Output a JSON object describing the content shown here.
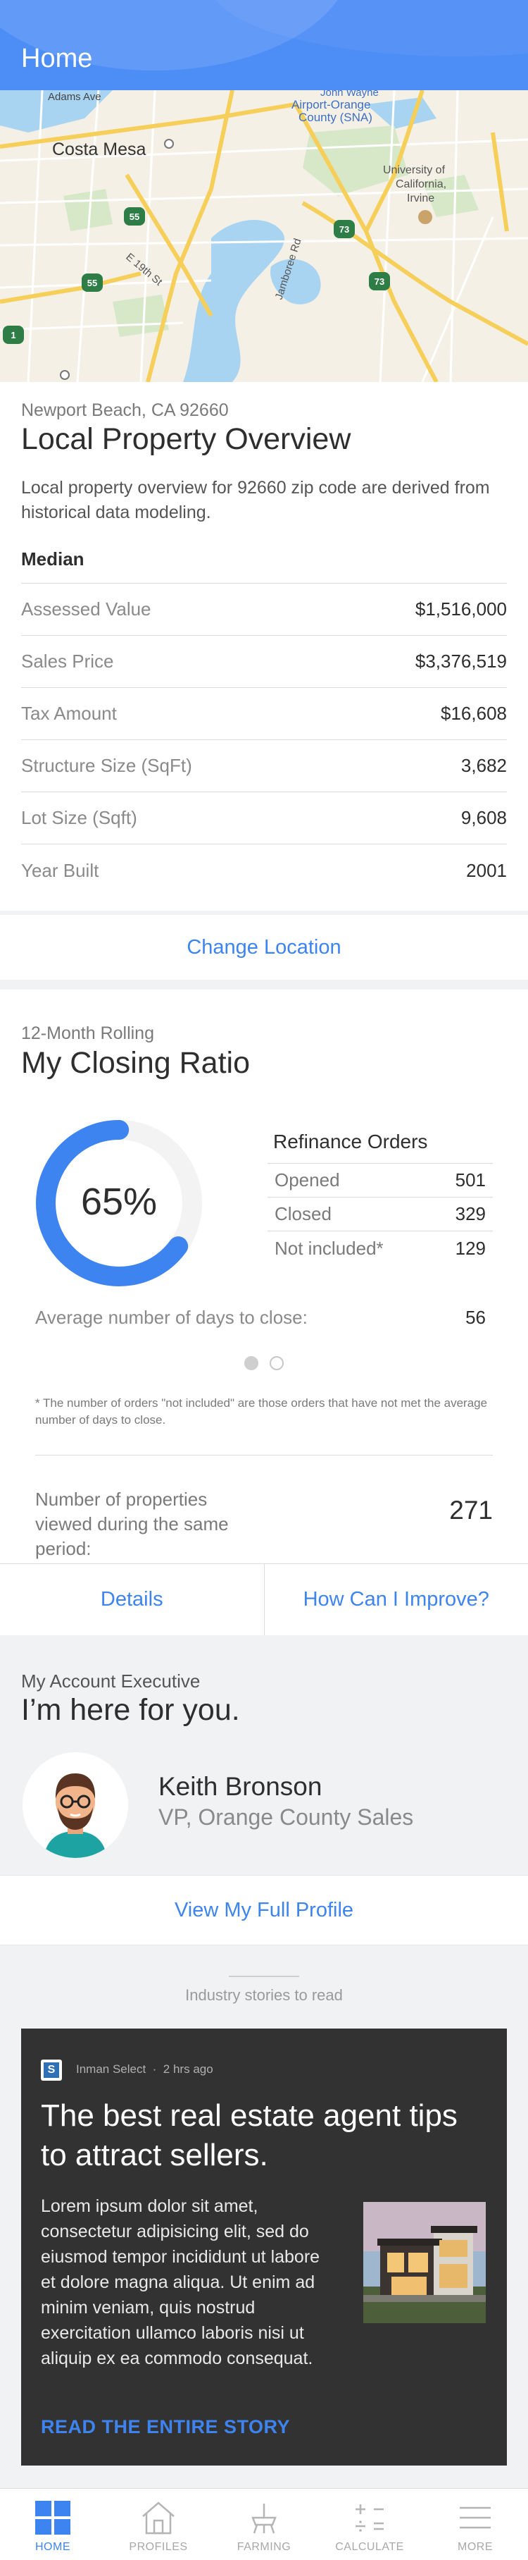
{
  "header": {
    "title": "Home"
  },
  "map": {
    "labels": {
      "adams_ave": "Adams Ave",
      "costa_mesa": "Costa Mesa",
      "airport": [
        "John Wayne",
        "Airport-Orange",
        "County (SNA)"
      ],
      "university": [
        "University of",
        "California,",
        "Irvine"
      ],
      "e19th": "E 19th St",
      "jamboree": "Jamboree Rd",
      "shield_55a": "55",
      "shield_55b": "55",
      "shield_73a": "73",
      "shield_73b": "73",
      "shield_1": "1"
    }
  },
  "overview": {
    "location": "Newport Beach, CA 92660",
    "title": "Local Property Overview",
    "description": "Local property overview for 92660 zip code are derived from historical data modeling.",
    "median_label": "Median",
    "rows": [
      {
        "label": "Assessed Value",
        "value": "$1,516,000"
      },
      {
        "label": "Sales Price",
        "value": "$3,376,519"
      },
      {
        "label": "Tax Amount",
        "value": "$16,608"
      },
      {
        "label": "Structure Size (SqFt)",
        "value": "3,682"
      },
      {
        "label": "Lot Size (Sqft)",
        "value": "9,608"
      },
      {
        "label": "Year Built",
        "value": "2001"
      }
    ],
    "change_location": "Change Location"
  },
  "closing": {
    "subtitle": "12-Month Rolling",
    "title": "My Closing Ratio",
    "percent_text": "65%",
    "percent_value": 0.65,
    "refinance_title": "Refinance Orders",
    "refinance_rows": [
      {
        "label": "Opened",
        "value": "501"
      },
      {
        "label": "Closed",
        "value": "329"
      },
      {
        "label": "Not included*",
        "value": "129"
      }
    ],
    "avg_label": "Average number of days to close:",
    "avg_value": "56",
    "footnote": "* The number of orders \"not included\" are those orders that have not met the average number of days to close.",
    "viewed_label": "Number of properties viewed during the same period:",
    "viewed_value": "271",
    "details_label": "Details",
    "improve_label": "How Can I Improve?",
    "accent_color": "#3d84f0"
  },
  "executive": {
    "subtitle": "My Account Executive",
    "title": "I’m here for you.",
    "name": "Keith Bronson",
    "role": "VP, Orange County Sales",
    "profile_link": "View My Full Profile"
  },
  "industry": {
    "label": "Industry stories to read"
  },
  "story": {
    "source": "Inman Select",
    "time": "2 hrs ago",
    "title": "The best real estate agent tips to attract sellers.",
    "body": "Lorem ipsum dolor sit amet, consectetur adipisicing elit, sed do eiusmod tempor incididunt ut labore et dolore magna aliqua. Ut enim ad minim veniam, quis nostrud exercitation ullamco laboris nisi ut aliquip ex ea commodo consequat.",
    "link": "READ THE ENTIRE STORY"
  },
  "tabbar": {
    "items": [
      {
        "label": "HOME",
        "icon": "home-grid-icon",
        "active": true
      },
      {
        "label": "PROFILES",
        "icon": "house-icon",
        "active": false
      },
      {
        "label": "FARMING",
        "icon": "farming-icon",
        "active": false
      },
      {
        "label": "CALCULATE",
        "icon": "calculator-icon",
        "active": false
      },
      {
        "label": "MORE",
        "icon": "menu-icon",
        "active": false
      }
    ]
  }
}
